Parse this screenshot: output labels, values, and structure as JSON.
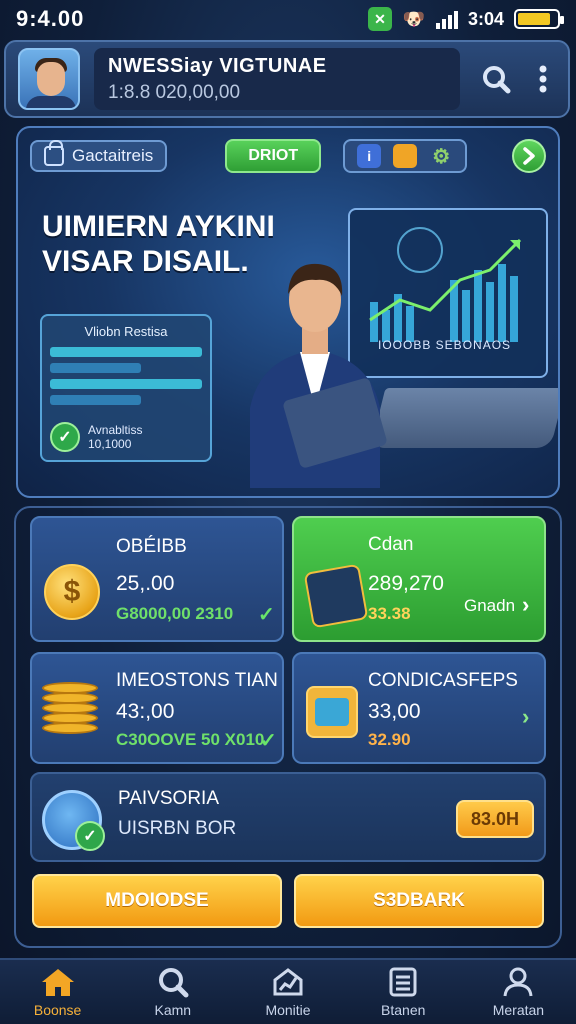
{
  "status_bar": {
    "time": "9:4.00",
    "right_time": "3:04",
    "battery_level": 0.85,
    "icons": [
      "app-green-icon",
      "dog-icon",
      "signal-icon",
      "battery-icon"
    ]
  },
  "header": {
    "title": "NWESSiay VIGTUNAE",
    "subtitle": "1:8.8 020,00,00",
    "icons": [
      "search-icon",
      "more-vertical-icon"
    ]
  },
  "hero": {
    "chip_label": "Gactaitreis",
    "green_button": "DRIOT",
    "tool_icons": [
      "info-icon",
      "box-icon",
      "gear-icon"
    ],
    "next_icon": "chevron-right-icon",
    "headline_line1": "UIMIERN AYKINI",
    "headline_line2": "VISAR DISAIL.",
    "panel_title": "Vliobn Restisa",
    "panel_footer_line1": "Avnabltiss",
    "panel_footer_line2": "10,1000",
    "screen_label": "IOOOBB SEBONAOS"
  },
  "cards": [
    {
      "title": "OBÉIBB",
      "value": "25,.00",
      "sub": "G8000,00 2310",
      "icon": "dollar-coin-icon",
      "status_icon": "check-icon",
      "style": "blue"
    },
    {
      "title": "Cdan",
      "value": "289,270",
      "sub": "33.38",
      "button": "Gnadn",
      "icon": "wallet-icon",
      "status_icon": "chevron-right-icon",
      "style": "green"
    },
    {
      "title": "IMEOSTONS TIAN",
      "value": "43:,00",
      "sub": "C30OOVE 50 X010",
      "icon": "coin-stack-icon",
      "status_icon": "check-icon",
      "style": "blue"
    },
    {
      "title": "CONDICASFEPS",
      "value": "33,00",
      "sub": "32.90",
      "icon": "gem-icon",
      "status_icon": "chevron-right-icon",
      "style": "blue"
    }
  ],
  "promo": {
    "line1": "PAIVSORIA",
    "line2": "UISRBN BOR",
    "badge": "83.0H",
    "icon": "shield-check-icon"
  },
  "actions": {
    "left": "MDOIODSE",
    "right": "S3DBARK"
  },
  "bottom_nav": [
    {
      "label": "Boonse",
      "icon": "home-icon",
      "active": true
    },
    {
      "label": "Kamn",
      "icon": "search-icon",
      "active": false
    },
    {
      "label": "Monitie",
      "icon": "chart-icon",
      "active": false
    },
    {
      "label": "Btanen",
      "icon": "list-icon",
      "active": false
    },
    {
      "label": "Meratan",
      "icon": "profile-icon",
      "active": false
    }
  ],
  "colors": {
    "background": "#0e1a30",
    "accent_green": "#3bb54a",
    "accent_gold": "#f29a12",
    "panel_blue": "#2e5594"
  }
}
